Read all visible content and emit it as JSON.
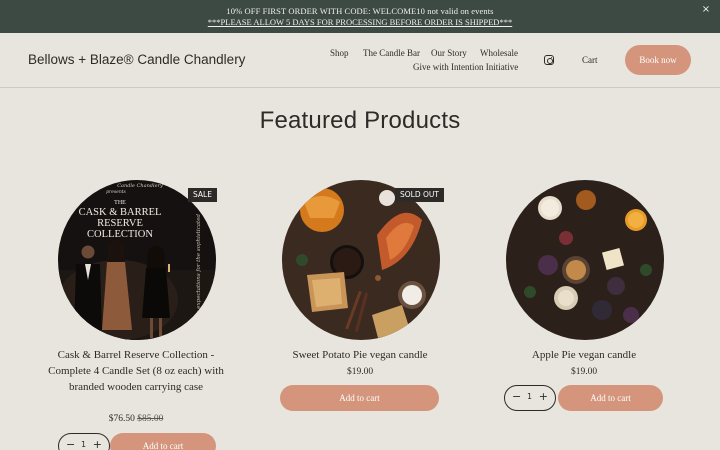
{
  "announcement": {
    "line1": "10% OFF FIRST ORDER WITH CODE: WELCOME10 not valid on events",
    "line2": "***PLEASE ALLOW 5 DAYS FOR PROCESSING BEFORE ORDER IS SHIPPED***",
    "close_glyph": "×"
  },
  "header": {
    "brand": "Bellows + Blaze® Candle Chandlery",
    "nav": [
      "Shop",
      "The Candle Bar",
      "Our Story",
      "Wholesale",
      "Give with Intention Initiative"
    ],
    "cart": "Cart",
    "book_now": "Book now"
  },
  "section_title": "Featured Products",
  "products": [
    {
      "badge": "SALE",
      "name": "Cask & Barrel Reserve Collection - Complete 4 Candle Set (8 oz each) with branded wooden carrying case",
      "price": "$76.50",
      "old_price": "$85.00",
      "qty": "1",
      "add_to_cart": "Add to cart",
      "image_text": {
        "top": "Candle Chandlery",
        "presents": "presents",
        "title1": "THE",
        "title2": "CASK & BARREL",
        "title3": "RESERVE",
        "title4": "COLLECTION",
        "side": "Candle expectations for the sophisticated"
      }
    },
    {
      "badge": "SOLD OUT",
      "name": "Sweet Potato Pie vegan candle",
      "price": "$19.00",
      "add_to_cart": "Add to cart"
    },
    {
      "name": "Apple Pie vegan candle",
      "price": "$19.00",
      "qty": "1",
      "add_to_cart": "Add to cart"
    }
  ],
  "icons": [
    "close-icon",
    "instagram-icon",
    "minus-icon",
    "plus-icon"
  ],
  "colors": {
    "announcement_bg": "#3d4a44",
    "accent": "#d4957c",
    "page_bg": "#e8e5df",
    "badge_bg": "#2e2a27"
  }
}
